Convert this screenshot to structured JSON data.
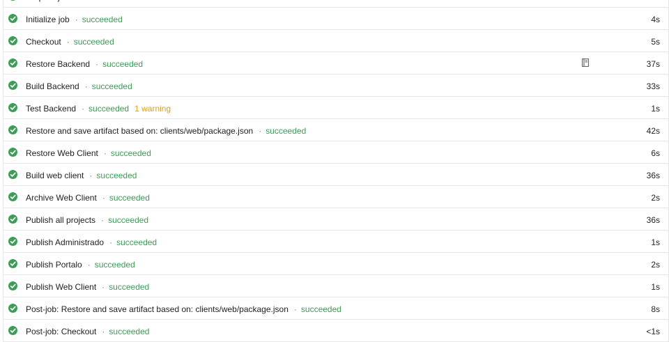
{
  "steps": [
    {
      "label": "Prepare job",
      "status": "succeeded",
      "duration": ""
    },
    {
      "label": "Initialize job",
      "status": "succeeded",
      "duration": "4s"
    },
    {
      "label": "Checkout",
      "status": "succeeded",
      "duration": "5s"
    },
    {
      "label": "Restore Backend",
      "status": "succeeded",
      "duration": "37s",
      "has_log_icon": true
    },
    {
      "label": "Build Backend",
      "status": "succeeded",
      "duration": "33s"
    },
    {
      "label": "Test Backend",
      "status": "succeeded",
      "warning": "1 warning",
      "duration": "1s"
    },
    {
      "label": "Restore and save artifact based on: clients/web/package.json",
      "status": "succeeded",
      "duration": "42s"
    },
    {
      "label": "Restore Web Client",
      "status": "succeeded",
      "duration": "6s"
    },
    {
      "label": "Build web client",
      "status": "succeeded",
      "duration": "36s"
    },
    {
      "label": "Archive Web Client",
      "status": "succeeded",
      "duration": "2s"
    },
    {
      "label": "Publish all projects",
      "status": "succeeded",
      "duration": "36s"
    },
    {
      "label": "Publish Administrado",
      "status": "succeeded",
      "duration": "1s"
    },
    {
      "label": "Publish Portalo",
      "status": "succeeded",
      "duration": "2s"
    },
    {
      "label": "Publish Web Client",
      "status": "succeeded",
      "duration": "1s"
    },
    {
      "label": "Post-job: Restore and save artifact based on: clients/web/package.json",
      "status": "succeeded",
      "duration": "8s"
    },
    {
      "label": "Post-job: Checkout",
      "status": "succeeded",
      "duration": "<1s"
    }
  ],
  "separator": "·",
  "colors": {
    "success": "#3f9b57",
    "warning": "#d9a21b",
    "text": "#1f1f1f",
    "separator": "#7a7a7a",
    "row_border": "#e8e8e8"
  },
  "icons": {
    "status": "check-circle-icon",
    "log": "notebook-icon"
  }
}
